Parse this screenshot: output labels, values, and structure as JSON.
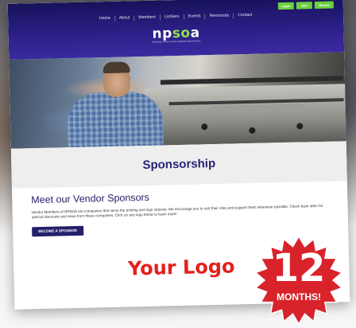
{
  "header": {
    "account_buttons": [
      "Login",
      "Join",
      "Renew"
    ],
    "nav": [
      "Home",
      "About",
      "Members",
      "ListServ",
      "Events",
      "Resources",
      "Contact"
    ],
    "logo_text_part1": "np",
    "logo_text_part2": "so",
    "logo_text_part3": "a",
    "logo_tagline": "NATIONAL PRINT & SIGN OWNERS ASSOCIATION"
  },
  "page": {
    "title": "Sponsorship",
    "section_heading": "Meet our Vendor Sponsors",
    "intro": "Vendor Members of NPSOA are companies that serve the printing and sign industry. We encourage you to visit their sites and support them whenever possible. Check back often for special discounts and news from these companies. Click on any logo below to learn more!",
    "cta_label": "BECOME A SPONSOR",
    "placeholder_logo": "Your Logo"
  },
  "badge": {
    "number": "12",
    "label": "MONTHS!",
    "color": "#d9232b"
  },
  "colors": {
    "header": "#2b1f86",
    "accent_green": "#6bd13f",
    "title": "#27237a",
    "logo_red": "#e3211c"
  }
}
